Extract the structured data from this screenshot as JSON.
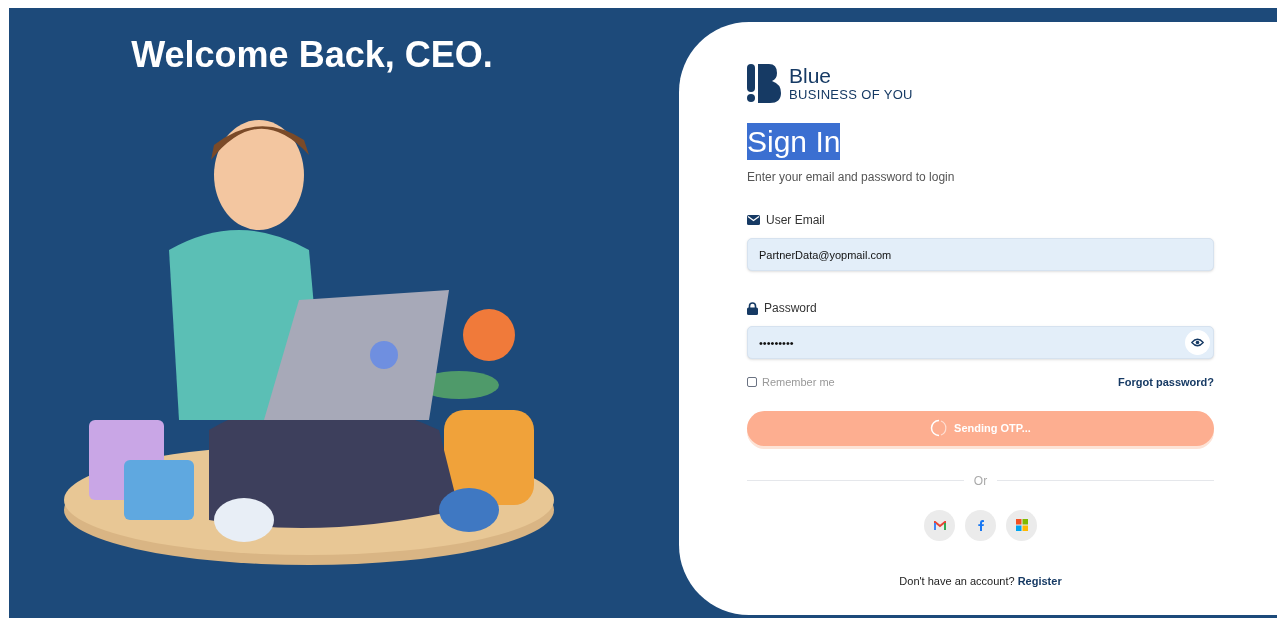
{
  "hero": {
    "title": "Welcome Back, CEO."
  },
  "brand": {
    "name": "Blue",
    "tagline": "BUSINESS OF YOU"
  },
  "heading": {
    "text": "Sign In",
    "highlighted": true
  },
  "subtitle": "Enter your email and password to login",
  "fields": [
    {
      "kind": "email",
      "label": "User Email",
      "value": "PartnerData@yopmail.com"
    },
    {
      "kind": "password",
      "label": "Password",
      "value": "•••••••••"
    }
  ],
  "remember": {
    "label": "Remember me",
    "checked": false
  },
  "forgot_link": "Forgot password?",
  "submit": {
    "label": "Sending OTP...",
    "loading": true
  },
  "divider": "Or",
  "social": [
    {
      "kind": "gmail"
    },
    {
      "kind": "facebook"
    },
    {
      "kind": "microsoft"
    }
  ],
  "footer": {
    "text": "Don't have an account?",
    "link": "Register"
  }
}
